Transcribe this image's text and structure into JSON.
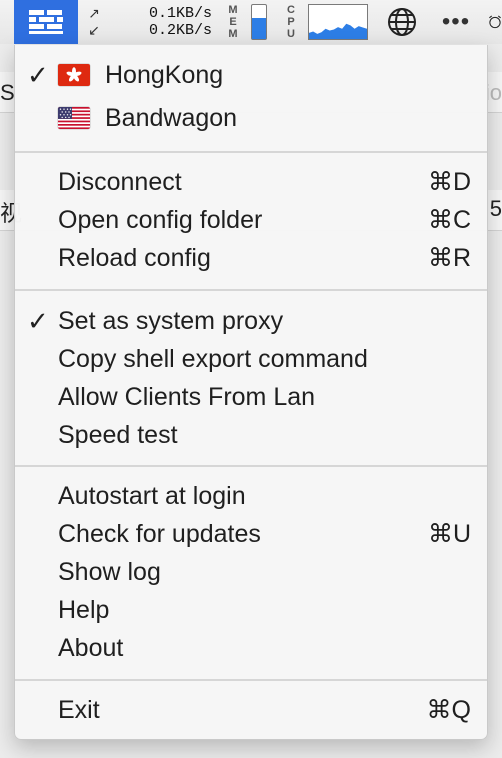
{
  "menubar": {
    "app_icon": "brick-wall-icon",
    "upload_arrow": "↗",
    "download_arrow": "↙",
    "upload_speed": "0.1KB/s",
    "download_speed": "0.2KB/s",
    "mem_label": [
      "M",
      "E",
      "M"
    ],
    "mem_usage_fraction": 0.62,
    "cpu_label": [
      "C",
      "P",
      "U"
    ],
    "cpu_history": [
      0.18,
      0.22,
      0.15,
      0.2,
      0.3,
      0.25,
      0.28,
      0.35,
      0.3,
      0.45,
      0.4,
      0.3,
      0.38,
      0.34,
      0.3
    ],
    "globe_icon": "globe-icon",
    "more_label": "•••",
    "accent": "#2d7ee6"
  },
  "menu": {
    "servers": [
      {
        "label": "HongKong",
        "checked": true,
        "flag": "hong-kong-flag-icon"
      },
      {
        "label": "Bandwagon",
        "checked": false,
        "flag": "us-flag-icon"
      }
    ],
    "connection": [
      {
        "label": "Disconnect",
        "shortcut": "⌘D"
      },
      {
        "label": "Open config folder",
        "shortcut": "⌘C"
      },
      {
        "label": "Reload config",
        "shortcut": "⌘R"
      }
    ],
    "proxy": [
      {
        "label": "Set as system proxy",
        "checked": true
      },
      {
        "label": "Copy shell export command"
      },
      {
        "label": "Allow Clients From Lan"
      },
      {
        "label": "Speed test"
      }
    ],
    "app": [
      {
        "label": "Autostart at login"
      },
      {
        "label": "Check for updates",
        "shortcut": "⌘U"
      },
      {
        "label": "Show log"
      },
      {
        "label": "Help"
      },
      {
        "label": "About"
      }
    ],
    "exit": {
      "label": "Exit",
      "shortcut": "⌘Q"
    },
    "check_mark": "✓"
  },
  "background": {
    "left_chars": [
      "S",
      "视"
    ],
    "right_chars": [
      "io",
      "5"
    ]
  }
}
